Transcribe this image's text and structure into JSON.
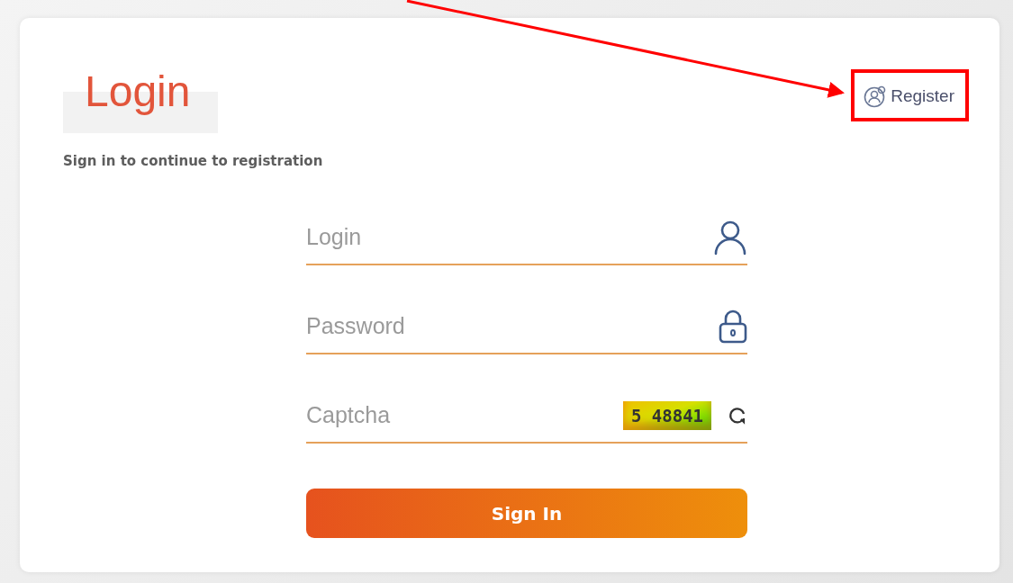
{
  "title": "Login",
  "subtitle": "Sign in to continue to registration",
  "register_link": {
    "label": "Register"
  },
  "fields": [
    {
      "kind": "user",
      "placeholder": "Login"
    },
    {
      "kind": "password",
      "placeholder": "Password"
    },
    {
      "kind": "captcha",
      "placeholder": "Captcha",
      "captcha": "5 48841"
    }
  ],
  "submit_button": {
    "label": "Sign In"
  }
}
